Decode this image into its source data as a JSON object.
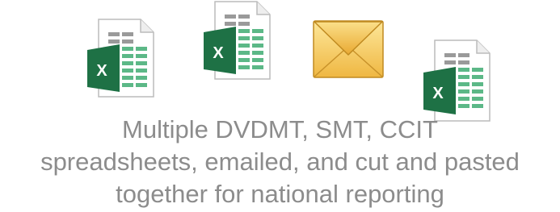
{
  "icons": {
    "spreadsheet_1": "excel-spreadsheet-icon",
    "spreadsheet_2": "excel-spreadsheet-icon",
    "email": "envelope-icon",
    "spreadsheet_3": "excel-spreadsheet-icon"
  },
  "icon_letter": "X",
  "caption": {
    "line1": "Multiple DVDMT, SMT, CCIT",
    "line2": "spreadsheets, emailed, and cut and pasted",
    "line3": "together for national reporting"
  },
  "colors": {
    "caption": "#8c8c8c",
    "excel_green": "#1e7145",
    "grid_green": "#5cb887",
    "envelope_gold": "#f2c14e"
  }
}
